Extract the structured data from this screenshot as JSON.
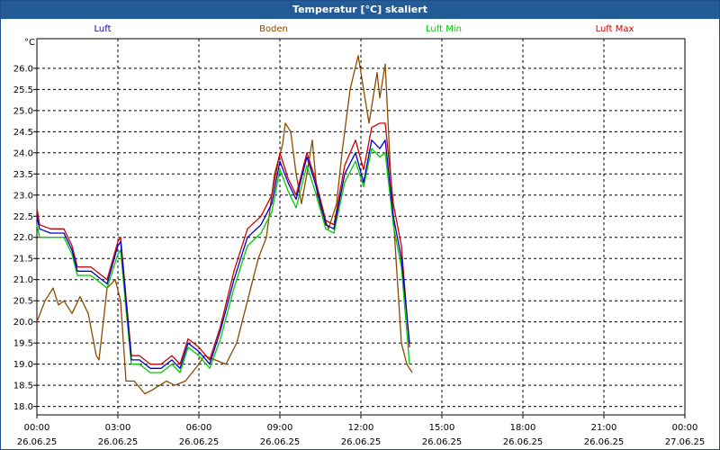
{
  "window": {
    "title": "Temperatur [°C] skaliert"
  },
  "colors": {
    "titlebar": "#225b96",
    "luft": "#0000cc",
    "boden": "#8b4a00",
    "luft_min": "#00cc00",
    "luft_max": "#cc0000",
    "grid": "#000000"
  },
  "chart_data": {
    "type": "line",
    "title": "Temperatur [°C] skaliert",
    "ylabel": "°C",
    "xlabel": "",
    "ylim": [
      17.8,
      26.7
    ],
    "xlim": [
      0,
      24
    ],
    "grid": true,
    "legend_position": "top",
    "yticks": [
      "18.0",
      "18.5",
      "19.0",
      "19.5",
      "20.0",
      "20.5",
      "21.0",
      "21.5",
      "22.0",
      "22.5",
      "23.0",
      "23.5",
      "24.0",
      "24.5",
      "25.0",
      "25.5",
      "26.0"
    ],
    "xticks": [
      {
        "x": 0,
        "time": "00:00",
        "date": "26.06.25"
      },
      {
        "x": 3,
        "time": "03:00",
        "date": "26.06.25"
      },
      {
        "x": 6,
        "time": "06:00",
        "date": "26.06.25"
      },
      {
        "x": 9,
        "time": "09:00",
        "date": "26.06.25"
      },
      {
        "x": 12,
        "time": "12:00",
        "date": "26.06.25"
      },
      {
        "x": 15,
        "time": "15:00",
        "date": "26.06.25"
      },
      {
        "x": 18,
        "time": "18:00",
        "date": "26.06.25"
      },
      {
        "x": 21,
        "time": "21:00",
        "date": "26.06.25"
      },
      {
        "x": 24,
        "time": "00:00",
        "date": "27.06.25"
      }
    ],
    "series": [
      {
        "name": "Luft",
        "color": "#0000cc",
        "x": [
          0,
          0.1,
          0.5,
          1.0,
          1.3,
          1.5,
          2.0,
          2.6,
          3.0,
          3.1,
          3.3,
          3.5,
          3.8,
          4.2,
          4.6,
          5.0,
          5.3,
          5.6,
          6.0,
          6.4,
          6.8,
          7.3,
          7.8,
          8.3,
          8.7,
          9.0,
          9.3,
          9.6,
          10.0,
          10.3,
          10.7,
          11.0,
          11.4,
          11.8,
          12.1,
          12.4,
          12.7,
          12.9,
          13.2,
          13.5,
          13.8
        ],
        "y": [
          22.5,
          22.2,
          22.1,
          22.1,
          21.7,
          21.2,
          21.2,
          20.9,
          21.8,
          21.9,
          20.5,
          19.1,
          19.1,
          18.9,
          18.9,
          19.1,
          18.9,
          19.5,
          19.3,
          19.0,
          19.8,
          21.0,
          22.0,
          22.3,
          22.8,
          23.8,
          23.3,
          22.9,
          23.9,
          23.3,
          22.3,
          22.2,
          23.5,
          24.0,
          23.3,
          24.3,
          24.1,
          24.3,
          22.5,
          21.5,
          19.5
        ]
      },
      {
        "name": "Boden",
        "color": "#8b4a00",
        "x": [
          0,
          0.3,
          0.6,
          0.8,
          1.0,
          1.3,
          1.6,
          1.9,
          2.2,
          2.3,
          2.6,
          2.9,
          3.1,
          3.3,
          3.6,
          4.0,
          4.3,
          4.8,
          5.1,
          5.5,
          6.0,
          6.2,
          6.6,
          7.0,
          7.4,
          7.8,
          8.2,
          8.5,
          8.8,
          9.1,
          9.2,
          9.4,
          9.6,
          9.8,
          10.0,
          10.2,
          10.4,
          10.8,
          11.1,
          11.3,
          11.5,
          11.6,
          11.9,
          12.1,
          12.3,
          12.6,
          12.7,
          12.9,
          13.1,
          13.3,
          13.5,
          13.7,
          13.9
        ],
        "y": [
          20.0,
          20.5,
          20.8,
          20.4,
          20.5,
          20.2,
          20.6,
          20.2,
          19.2,
          19.1,
          20.8,
          21.0,
          20.5,
          18.6,
          18.6,
          18.3,
          18.4,
          18.6,
          18.5,
          18.6,
          19.0,
          19.2,
          19.1,
          19.0,
          19.5,
          20.5,
          21.5,
          22.0,
          23.5,
          24.2,
          24.7,
          24.5,
          23.5,
          22.8,
          23.5,
          24.3,
          22.9,
          22.2,
          22.8,
          24.0,
          25.0,
          25.5,
          26.3,
          25.5,
          24.7,
          25.9,
          25.3,
          26.1,
          23.5,
          21.5,
          19.5,
          19.0,
          18.8
        ]
      },
      {
        "name": "Luft Min",
        "color": "#00cc00",
        "x": [
          0,
          0.1,
          0.5,
          1.0,
          1.3,
          1.5,
          2.0,
          2.6,
          3.0,
          3.1,
          3.3,
          3.5,
          3.8,
          4.2,
          4.6,
          5.0,
          5.3,
          5.6,
          6.0,
          6.4,
          6.8,
          7.3,
          7.8,
          8.3,
          8.7,
          9.0,
          9.3,
          9.6,
          10.0,
          10.3,
          10.7,
          11.0,
          11.4,
          11.8,
          12.1,
          12.4,
          12.7,
          12.9,
          13.2,
          13.5,
          13.8
        ],
        "y": [
          22.3,
          22.0,
          22.0,
          22.0,
          21.6,
          21.1,
          21.1,
          20.8,
          21.6,
          21.7,
          20.3,
          19.0,
          19.0,
          18.8,
          18.8,
          19.0,
          18.8,
          19.4,
          19.2,
          18.9,
          19.6,
          20.8,
          21.8,
          22.1,
          22.6,
          23.6,
          23.1,
          22.7,
          23.7,
          23.1,
          22.2,
          22.1,
          23.3,
          23.8,
          23.2,
          24.1,
          23.9,
          24.0,
          22.3,
          21.3,
          19.0
        ]
      },
      {
        "name": "Luft Max",
        "color": "#cc0000",
        "x": [
          0,
          0.1,
          0.5,
          1.0,
          1.3,
          1.5,
          2.0,
          2.6,
          3.0,
          3.1,
          3.3,
          3.5,
          3.8,
          4.2,
          4.6,
          5.0,
          5.3,
          5.6,
          6.0,
          6.4,
          6.8,
          7.3,
          7.8,
          8.3,
          8.7,
          9.0,
          9.3,
          9.6,
          10.0,
          10.3,
          10.7,
          11.0,
          11.4,
          11.8,
          12.1,
          12.4,
          12.7,
          12.9,
          13.2,
          13.5,
          13.8
        ],
        "y": [
          22.7,
          22.3,
          22.2,
          22.2,
          21.8,
          21.3,
          21.3,
          21.0,
          21.9,
          22.0,
          20.6,
          19.2,
          19.2,
          19.0,
          19.0,
          19.2,
          19.0,
          19.6,
          19.4,
          19.1,
          19.9,
          21.2,
          22.2,
          22.5,
          23.0,
          24.0,
          23.4,
          23.0,
          24.0,
          23.4,
          22.4,
          22.3,
          23.7,
          24.3,
          23.6,
          24.6,
          24.7,
          24.7,
          22.8,
          21.8,
          19.4
        ]
      }
    ]
  }
}
